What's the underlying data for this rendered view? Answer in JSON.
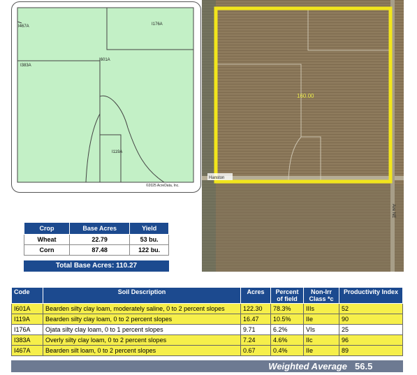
{
  "soil_map": {
    "labels": [
      "I467A",
      "I176A",
      "I383A",
      "I601A",
      "I119A"
    ],
    "copyright": "©2025 AcreData, Inc."
  },
  "aerial": {
    "acres_label": "160.00",
    "road_label_left": "Hanston",
    "road_label_right": "Ave NE",
    "boundary_color": "#f2e51c"
  },
  "crop_table": {
    "headers": [
      "Crop",
      "Base Acres",
      "Yield"
    ],
    "rows": [
      {
        "crop": "Wheat",
        "base_acres": "22.79",
        "yield": "53 bu."
      },
      {
        "crop": "Corn",
        "base_acres": "87.48",
        "yield": "122 bu."
      }
    ],
    "total": "Total Base Acres: 110.27"
  },
  "soil_table": {
    "headers": {
      "code": "Code",
      "description": "Soil Description",
      "acres": "Acres",
      "percent": "Percent of field",
      "class": "Non-Irr Class *c",
      "productivity": "Productivity Index"
    },
    "rows": [
      {
        "code": "I601A",
        "description": "Bearden silty clay loam, moderately saline, 0 to 2 percent slopes",
        "acres": "122.30",
        "percent": "78.3%",
        "class": "IIIs",
        "productivity": "52",
        "highlight": true
      },
      {
        "code": "I119A",
        "description": "Bearden silty clay loam, 0 to 2 percent slopes",
        "acres": "16.47",
        "percent": "10.5%",
        "class": "IIe",
        "productivity": "90",
        "highlight": true
      },
      {
        "code": "I176A",
        "description": "Ojata silty clay loam, 0 to 1 percent slopes",
        "acres": "9.71",
        "percent": "6.2%",
        "class": "VIs",
        "productivity": "25",
        "highlight": false
      },
      {
        "code": "I383A",
        "description": "Overly silty clay loam, 0 to 2 percent slopes",
        "acres": "7.24",
        "percent": "4.6%",
        "class": "IIc",
        "productivity": "96",
        "highlight": true
      },
      {
        "code": "I467A",
        "description": "Bearden silt loam, 0 to 2 percent slopes",
        "acres": "0.67",
        "percent": "0.4%",
        "class": "IIe",
        "productivity": "89",
        "highlight": true
      }
    ],
    "weighted_average_label": "Weighted Average",
    "weighted_average_value": "56.5"
  },
  "colors": {
    "header_blue": "#1c4a8f",
    "row_yellow": "#f6ef4a",
    "map_green": "#c3f0c6",
    "footer_gray": "#6d7a92"
  }
}
